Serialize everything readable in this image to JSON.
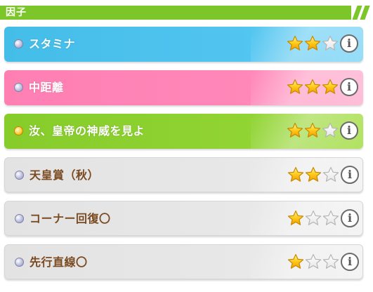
{
  "header": {
    "title": "因子",
    "color": "#7cc629"
  },
  "factors": [
    {
      "label": "スタミナ",
      "theme": "blue",
      "orb": "silver",
      "stars": 2,
      "max_stars": 3,
      "info": "i"
    },
    {
      "label": "中距離",
      "theme": "pink",
      "orb": "silver",
      "stars": 3,
      "max_stars": 3,
      "info": "i"
    },
    {
      "label": "汝、皇帝の神威を見よ",
      "theme": "green",
      "orb": "gold",
      "stars": 2,
      "max_stars": 3,
      "info": "i"
    },
    {
      "label": "天皇賞（秋）",
      "theme": "gray",
      "orb": "silver",
      "stars": 2,
      "max_stars": 3,
      "info": "i"
    },
    {
      "label": "コーナー回復〇",
      "theme": "gray",
      "orb": "silver",
      "stars": 1,
      "max_stars": 3,
      "info": "i"
    },
    {
      "label": "先行直線〇",
      "theme": "gray",
      "orb": "silver",
      "stars": 1,
      "max_stars": 3,
      "info": "i"
    }
  ],
  "colors": {
    "blue": "#44bde9",
    "pink": "#ff7fb3",
    "green": "#86cc2a",
    "gray": "#e3e3e3",
    "star_filled": "#ffcc1a",
    "label_dark": "#7a4a21"
  }
}
